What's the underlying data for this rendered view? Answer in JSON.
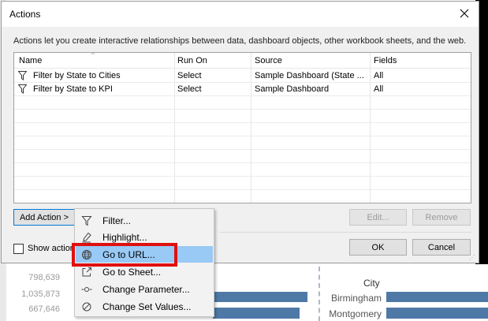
{
  "background": {
    "numbers": [
      "798,639",
      "1,035,873",
      "667,646"
    ],
    "city_header": "City",
    "cities": [
      "Birmingham",
      "Montgomery"
    ],
    "bar_color": "#4e79a7"
  },
  "dialog": {
    "title": "Actions",
    "description": "Actions let you create interactive relationships between data, dashboard objects, other workbook sheets, and the web.",
    "columns": [
      "Name",
      "Run On",
      "Source",
      "Fields"
    ],
    "rows": [
      {
        "name": "Filter by State to Cities",
        "run_on": "Select",
        "source": "Sample Dashboard (State ...",
        "fields": "All",
        "icon": "filter-icon"
      },
      {
        "name": "Filter by State to KPI",
        "run_on": "Select",
        "source": "Sample Dashboard",
        "fields": "All",
        "icon": "filter-icon"
      }
    ],
    "add_action_label": "Add Action >",
    "edit_label": "Edit...",
    "remove_label": "Remove",
    "show_label": "Show action",
    "ok_label": "OK",
    "cancel_label": "Cancel"
  },
  "menu": {
    "items": [
      {
        "label": "Filter...",
        "icon": "filter-icon"
      },
      {
        "label": "Highlight...",
        "icon": "highlighter-icon"
      },
      {
        "label": "Go to URL...",
        "icon": "globe-icon",
        "hovered": true
      },
      {
        "label": "Go to Sheet...",
        "icon": "go-to-sheet-icon"
      },
      {
        "label": "Change Parameter...",
        "icon": "parameter-icon"
      },
      {
        "label": "Change Set Values...",
        "icon": "set-values-icon"
      }
    ]
  },
  "colors": {
    "selection": "#99c9f5",
    "highlight_box": "#e01010",
    "focus_border": "#0078d7"
  }
}
